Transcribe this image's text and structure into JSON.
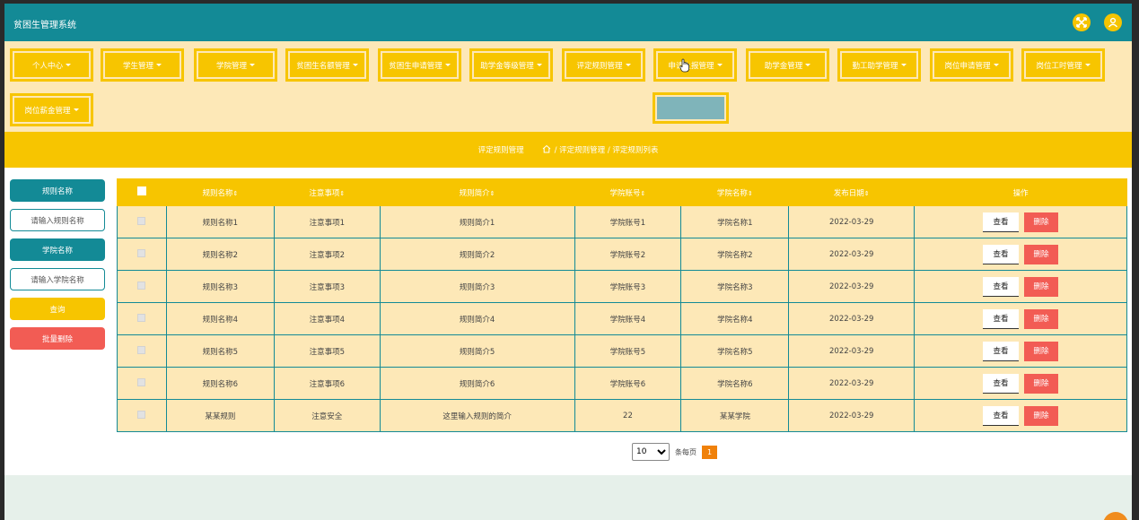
{
  "header": {
    "title": "贫困生管理系统"
  },
  "nav": [
    "个人中心",
    "学生管理",
    "学院管理",
    "贫困生名额管理",
    "贫困生申请管理",
    "助学金等级管理",
    "评定规则管理",
    "申请上报管理",
    "助学金管理",
    "勤工助学管理",
    "岗位申请管理",
    "岗位工时管理",
    "岗位薪金管理"
  ],
  "breadcrumb": {
    "section": "评定规则管理",
    "path": "/ 评定规则管理 / 评定规则列表"
  },
  "search": {
    "rule_label": "规则名称",
    "rule_placeholder": "请输入规则名称",
    "college_label": "学院名称",
    "college_placeholder": "请输入学院名称",
    "query_button": "查询",
    "batch_delete_button": "批量删除"
  },
  "table": {
    "headers": [
      "规则名称",
      "注意事项",
      "规则简介",
      "学院账号",
      "学院名称",
      "发布日期",
      "操作"
    ],
    "rows": [
      [
        "规则名称1",
        "注意事项1",
        "规则简介1",
        "学院账号1",
        "学院名称1",
        "2022-03-29"
      ],
      [
        "规则名称2",
        "注意事项2",
        "规则简介2",
        "学院账号2",
        "学院名称2",
        "2022-03-29"
      ],
      [
        "规则名称3",
        "注意事项3",
        "规则简介3",
        "学院账号3",
        "学院名称3",
        "2022-03-29"
      ],
      [
        "规则名称4",
        "注意事项4",
        "规则简介4",
        "学院账号4",
        "学院名称4",
        "2022-03-29"
      ],
      [
        "规则名称5",
        "注意事项5",
        "规则简介5",
        "学院账号5",
        "学院名称5",
        "2022-03-29"
      ],
      [
        "规则名称6",
        "注意事项6",
        "规则简介6",
        "学院账号6",
        "学院名称6",
        "2022-03-29"
      ],
      [
        "某某规则",
        "注意安全",
        "这里输入规则的简介",
        "22",
        "某某学院",
        "2022-03-29"
      ]
    ],
    "view_label": "查看",
    "delete_label": "删除"
  },
  "pagination": {
    "page_size": "10",
    "per_page_label": "条每页",
    "current_page": "1"
  },
  "colors": {
    "teal": "#138a96",
    "yellow": "#f7c500",
    "cream": "#fde8b7",
    "red": "#f25c54"
  }
}
